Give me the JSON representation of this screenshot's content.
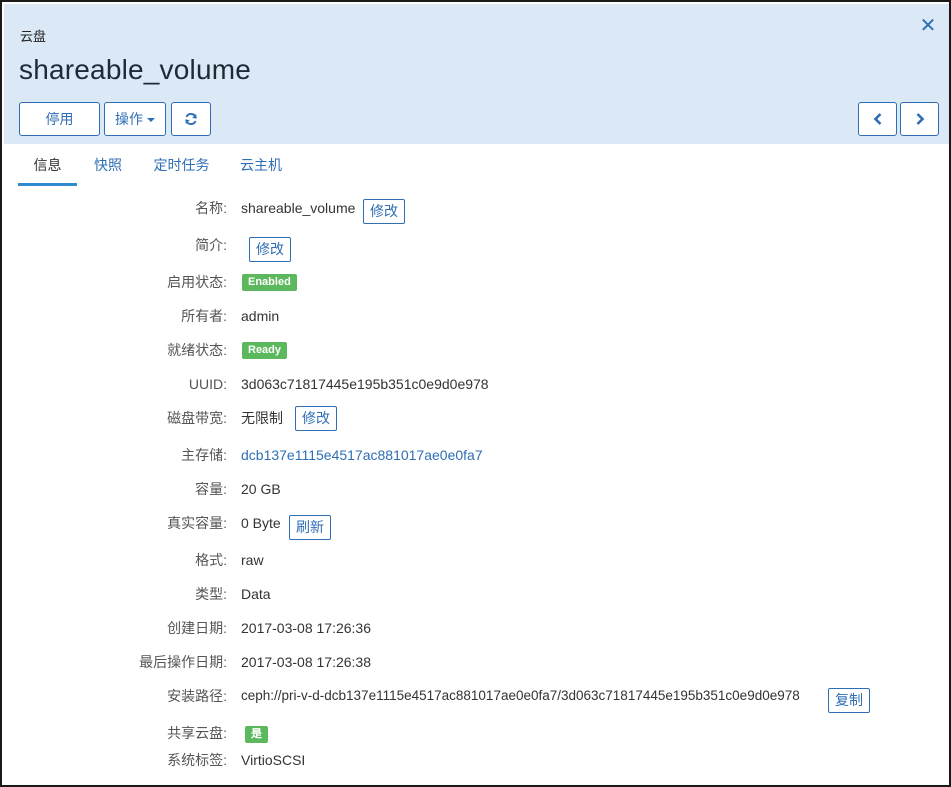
{
  "header": {
    "breadcrumb": "云盘",
    "title": "shareable_volume",
    "close_icon": "times-icon",
    "buttons": {
      "disable": "停用",
      "actions": "操作",
      "refresh_icon": "refresh-icon",
      "prev_icon": "chevron-left-icon",
      "next_icon": "chevron-right-icon"
    }
  },
  "tabs": [
    {
      "label": "信息",
      "active": true
    },
    {
      "label": "快照",
      "active": false
    },
    {
      "label": "定时任务",
      "active": false
    },
    {
      "label": "云主机",
      "active": false
    }
  ],
  "details": {
    "name": {
      "label": "名称:",
      "value": "shareable_volume",
      "action": "修改"
    },
    "description": {
      "label": "简介:",
      "value": "",
      "action": "修改"
    },
    "enable_state": {
      "label": "启用状态:",
      "badge": "Enabled"
    },
    "owner": {
      "label": "所有者:",
      "value": "admin"
    },
    "ready_state": {
      "label": "就绪状态:",
      "badge": "Ready"
    },
    "uuid": {
      "label": "UUID:",
      "value": "3d063c71817445e195b351c0e9d0e978"
    },
    "disk_bandwidth": {
      "label": "磁盘带宽:",
      "value": "无限制",
      "action": "修改"
    },
    "primary_storage": {
      "label": "主存储:",
      "value": "dcb137e1115e4517ac881017ae0e0fa7"
    },
    "capacity": {
      "label": "容量:",
      "value": "20 GB"
    },
    "actual_capacity": {
      "label": "真实容量:",
      "value": "0 Byte",
      "action": "刷新"
    },
    "format": {
      "label": "格式:",
      "value": "raw"
    },
    "type": {
      "label": "类型:",
      "value": "Data"
    },
    "created": {
      "label": "创建日期:",
      "value": "2017-03-08 17:26:36"
    },
    "last_op": {
      "label": "最后操作日期:",
      "value": "2017-03-08 17:26:38"
    },
    "install_path": {
      "label": "安装路径:",
      "value": "ceph://pri-v-d-dcb137e1115e4517ac881017ae0e0fa7/3d063c71817445e195b351c0e9d0e978",
      "action": "复制"
    },
    "shareable": {
      "label": "共享云盘:",
      "badge": "是"
    },
    "system_tags": {
      "label": "系统标签:",
      "value": "VirtioSCSI"
    }
  },
  "colors": {
    "header_bg": "#dbe8f5",
    "accent": "#2f6eb5",
    "success": "#5cb85c"
  }
}
